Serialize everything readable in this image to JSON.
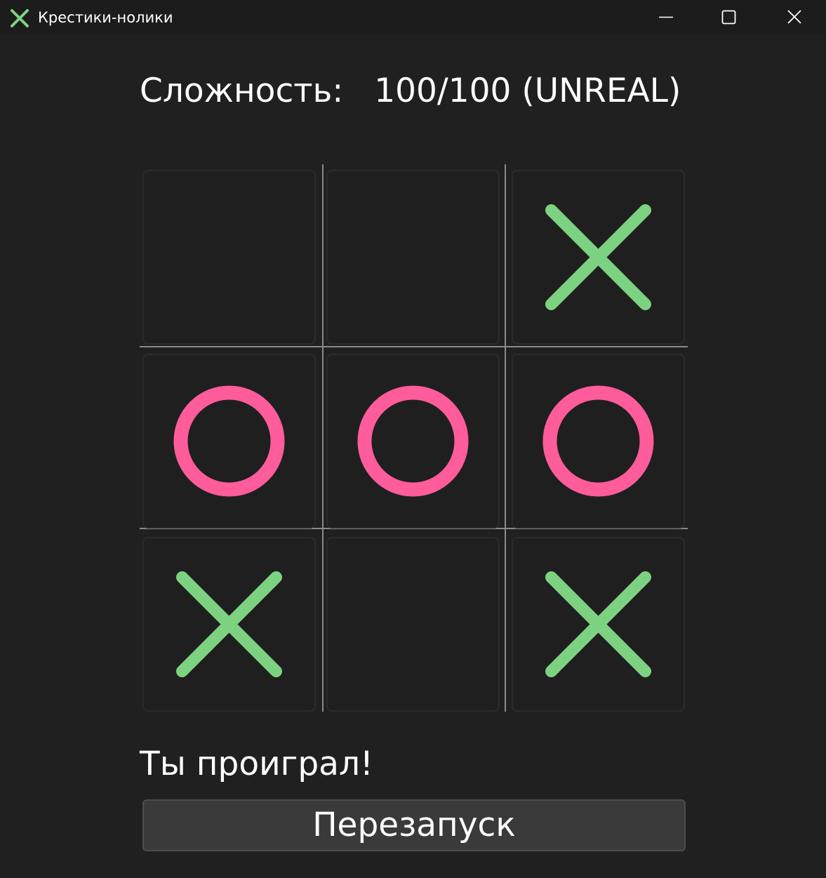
{
  "window": {
    "title": "Крестики-нолики",
    "icon": "cross-icon",
    "controls": [
      "minimize-icon",
      "maximize-icon",
      "close-icon"
    ]
  },
  "difficulty": {
    "label": "Сложность:",
    "value": "100/100 (UNREAL)"
  },
  "board": {
    "cells": [
      "",
      "",
      "X",
      "O",
      "O",
      "O",
      "X",
      "",
      "X"
    ]
  },
  "status": "Ты проиграл!",
  "restart_label": "Перезапуск",
  "colors": {
    "x": "#7dd282",
    "o": "#ff5c9b",
    "background": "#202020"
  }
}
